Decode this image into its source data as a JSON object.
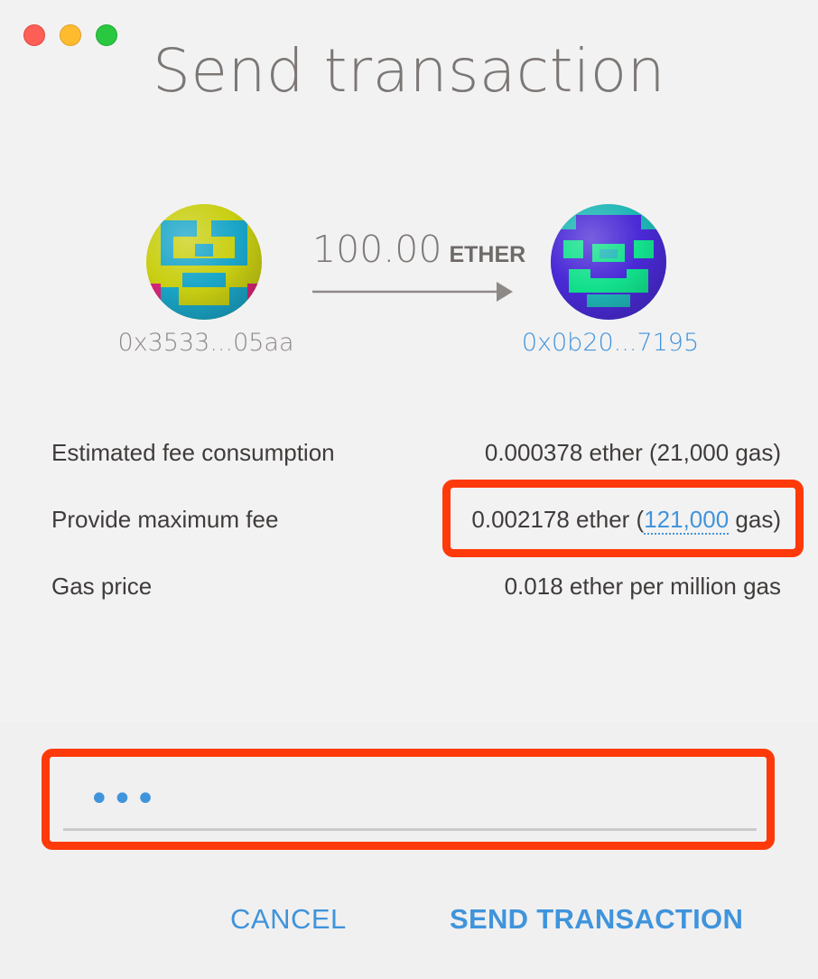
{
  "window": {
    "title": "Send transaction",
    "controls": [
      "close",
      "minimize",
      "zoom"
    ],
    "colors": {
      "close": "#fd5f57",
      "minimize": "#febb2e",
      "zoom": "#29c840"
    }
  },
  "transfer": {
    "amount": "100.00",
    "unit": "ETHER",
    "from_address": "0x3533...05aa",
    "to_address": "0x0b20...7195",
    "from_identicon": "from-identicon",
    "to_identicon": "to-identicon"
  },
  "fees": {
    "estimated": {
      "label": "Estimated fee consumption",
      "value": "0.000378 ether (21,000 gas)"
    },
    "maximum": {
      "label": "Provide maximum fee",
      "value_prefix": "0.002178 ether (",
      "gas_link": "121,000",
      "value_suffix": " gas)"
    },
    "gas_price": {
      "label": "Gas price",
      "value": "0.018 ether per million gas"
    }
  },
  "password": {
    "value": "•••"
  },
  "actions": {
    "cancel": "CANCEL",
    "send": "SEND TRANSACTION"
  },
  "colors": {
    "accent": "#3f94dc",
    "highlight": "#fe3a0a",
    "text": "#3f3c3b"
  }
}
